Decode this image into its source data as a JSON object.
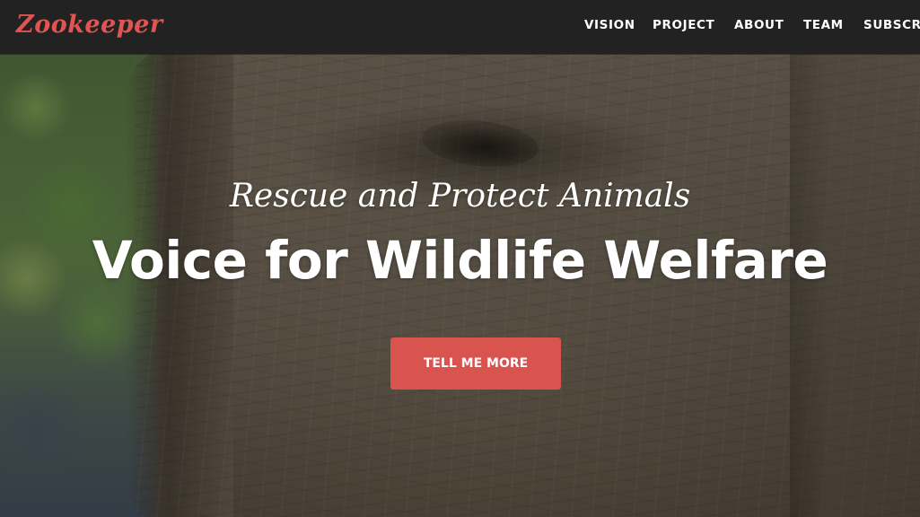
{
  "brand": {
    "name": "Zookeeper",
    "color": "#e05451"
  },
  "nav": {
    "items": [
      {
        "label": "VISION"
      },
      {
        "label": "PROJECT"
      },
      {
        "label": "ABOUT"
      },
      {
        "label": "TEAM"
      },
      {
        "label": "SUBSCRI"
      }
    ]
  },
  "hero": {
    "subtitle": "Rescue and Protect Animals",
    "headline": "Voice for Wildlife Welfare",
    "cta_label": "TELL ME MORE",
    "cta_color": "#d9534f",
    "background_image": "elephant-closeup"
  }
}
